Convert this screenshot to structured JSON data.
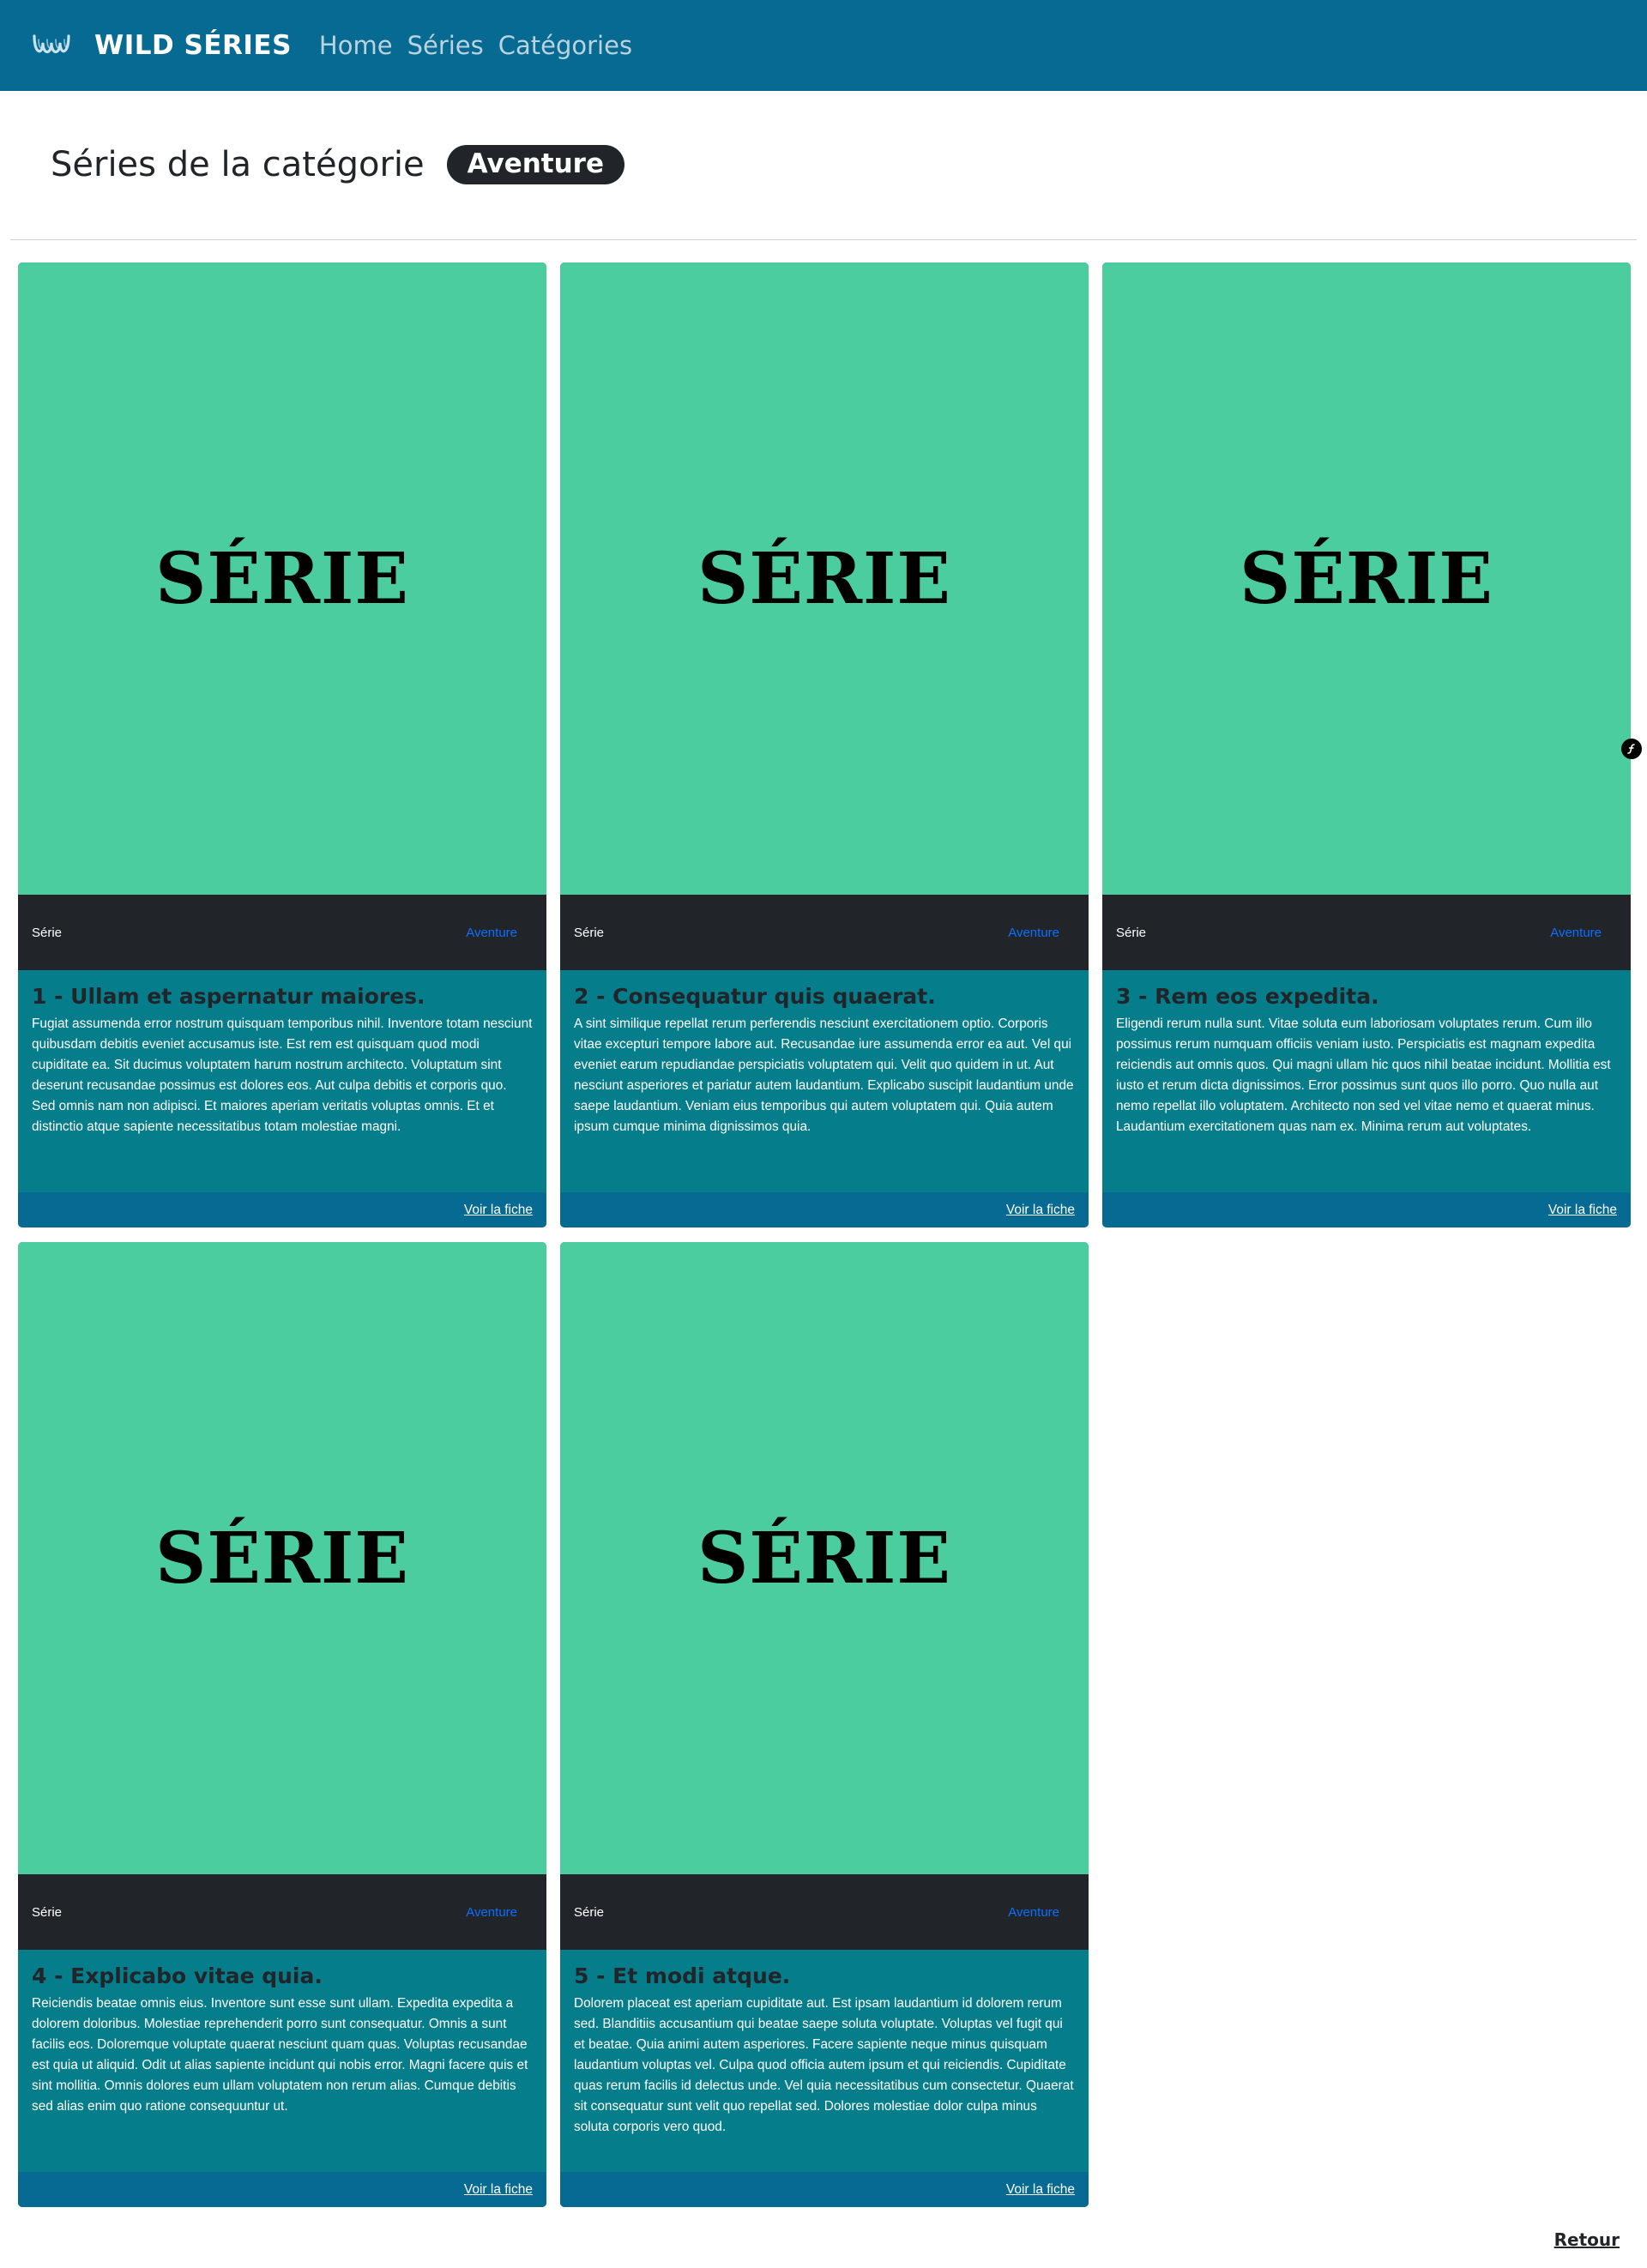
{
  "navbar": {
    "brand": "WILD SÉRIES",
    "links": [
      "Home",
      "Séries",
      "Catégories"
    ]
  },
  "page": {
    "title": "Séries de la catégorie",
    "category_badge": "Aventure",
    "back_label": "Retour"
  },
  "colors": {
    "navbar": "#076a93",
    "thumb": "#4ccda0",
    "card_body": "#057d8b",
    "meta_bar": "#212529",
    "category_link": "#0d6efd"
  },
  "cards": [
    {
      "thumb_text": "SÉRIE",
      "type": "Série",
      "category": "Aventure",
      "title": "1 - Ullam et aspernatur maiores.",
      "synopsis": "Fugiat assumenda error nostrum quisquam temporibus nihil. Inventore totam nesciunt quibusdam debitis eveniet accusamus iste. Est rem est quisquam quod modi cupiditate ea. Sit ducimus voluptatem harum nostrum architecto. Voluptatum sint deserunt recusandae possimus est dolores eos. Aut culpa debitis et corporis quo. Sed omnis nam non adipisci. Et maiores aperiam veritatis voluptas omnis. Et et distinctio atque sapiente necessitatibus totam molestiae magni.",
      "link": "Voir la fiche"
    },
    {
      "thumb_text": "SÉRIE",
      "type": "Série",
      "category": "Aventure",
      "title": "2 - Consequatur quis quaerat.",
      "synopsis": "A sint similique repellat rerum perferendis nesciunt exercitationem optio. Corporis vitae excepturi tempore labore aut. Recusandae iure assumenda error ea aut. Vel qui eveniet earum repudiandae perspiciatis voluptatem qui. Velit quo quidem in ut. Aut nesciunt asperiores et pariatur autem laudantium. Explicabo suscipit laudantium unde saepe laudantium. Veniam eius temporibus qui autem voluptatem qui. Quia autem ipsum cumque minima dignissimos quia.",
      "link": "Voir la fiche"
    },
    {
      "thumb_text": "SÉRIE",
      "type": "Série",
      "category": "Aventure",
      "title": "3 - Rem eos expedita.",
      "synopsis": "Eligendi rerum nulla sunt. Vitae soluta eum laboriosam voluptates rerum. Cum illo possimus rerum numquam officiis veniam iusto. Perspiciatis est magnam expedita reiciendis aut omnis quos. Qui magni ullam hic quos nihil beatae incidunt. Mollitia est iusto et rerum dicta dignissimos. Error possimus sunt quos illo porro. Quo nulla aut nemo repellat illo voluptatem. Architecto non sed vel vitae nemo et quaerat minus. Laudantium exercitationem quas nam ex. Minima rerum aut voluptates.",
      "link": "Voir la fiche"
    },
    {
      "thumb_text": "SÉRIE",
      "type": "Série",
      "category": "Aventure",
      "title": "4 - Explicabo vitae quia.",
      "synopsis": "Reiciendis beatae omnis eius. Inventore sunt esse sunt ullam. Expedita expedita a dolorem doloribus. Molestiae reprehenderit porro sunt consequatur. Omnis a sunt facilis eos. Doloremque voluptate quaerat nesciunt quam quas. Voluptas recusandae est quia ut aliquid. Odit ut alias sapiente incidunt qui nobis error. Magni facere quis et sint mollitia. Omnis dolores eum ullam voluptatem non rerum alias. Cumque debitis sed alias enim quo ratione consequuntur ut.",
      "link": "Voir la fiche"
    },
    {
      "thumb_text": "SÉRIE",
      "type": "Série",
      "category": "Aventure",
      "title": "5 - Et modi atque.",
      "synopsis": "Dolorem placeat est aperiam cupiditate aut. Est ipsam laudantium id dolorem rerum sed. Blanditiis accusantium qui beatae saepe soluta voluptate. Voluptas vel fugit qui et beatae. Quia animi autem asperiores. Facere sapiente neque minus quisquam laudantium voluptas vel. Culpa quod officia autem ipsum et qui reiciendis. Cupiditate quas rerum facilis id delectus unde. Vel quia necessitatibus cum consectetur. Quaerat sit consequatur sunt velit quo repellat sed. Dolores molestiae dolor culpa minus soluta corporis vero quod.",
      "link": "Voir la fiche"
    }
  ]
}
